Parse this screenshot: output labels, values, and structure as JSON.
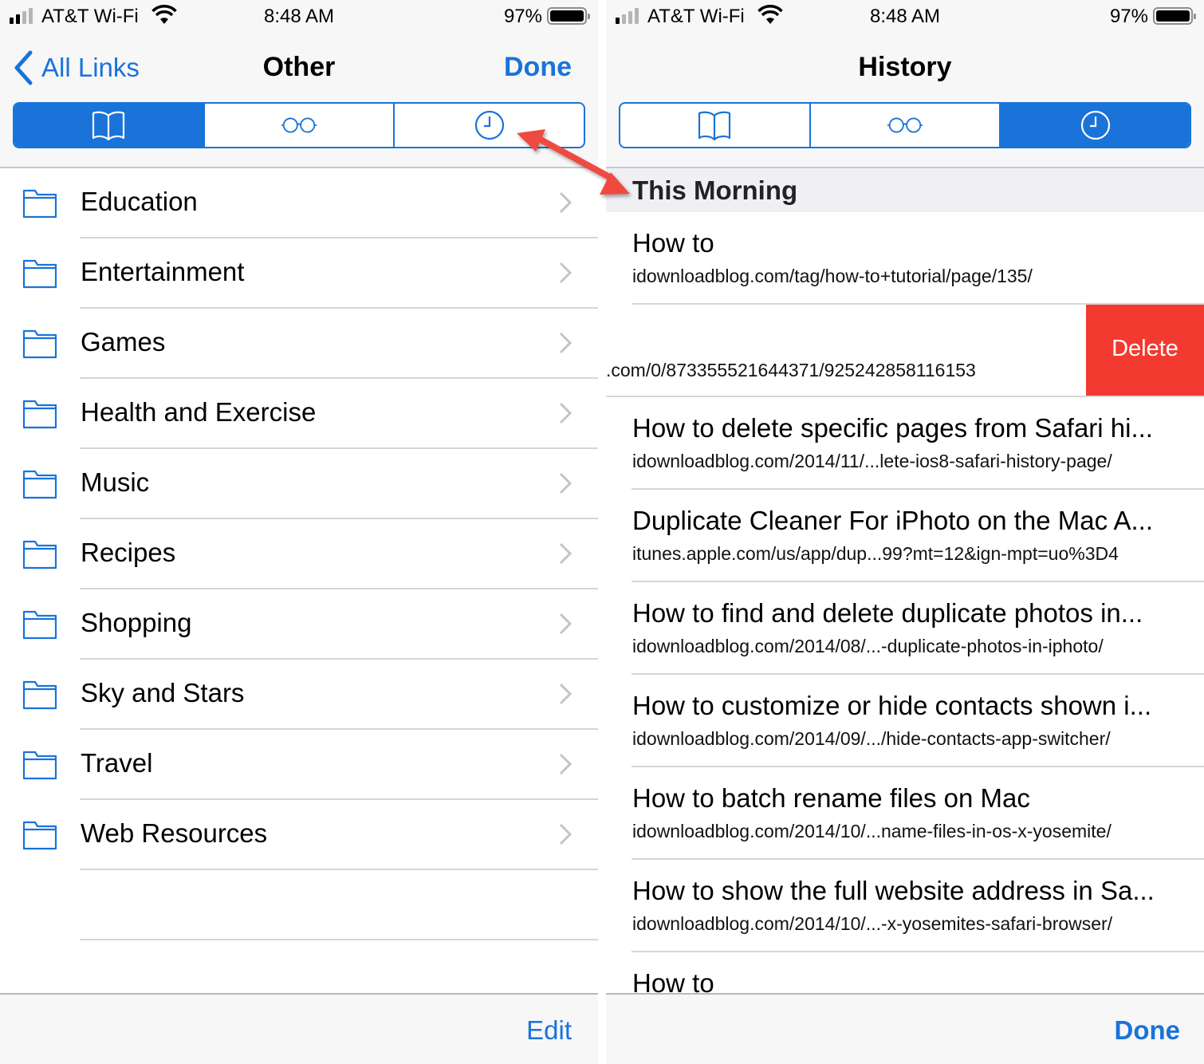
{
  "colors": {
    "accent": "#1a73d9",
    "delete": "#f23a30",
    "annotation_arrow": "#ef4a3f"
  },
  "left_screen": {
    "status_bar": {
      "carrier": "AT&T Wi-Fi",
      "time": "8:48 AM",
      "battery": "97%"
    },
    "nav": {
      "back_label": "All Links",
      "title": "Other",
      "done_label": "Done"
    },
    "segments": [
      {
        "icon": "book-icon",
        "active": true
      },
      {
        "icon": "glasses-icon",
        "active": false
      },
      {
        "icon": "clock-icon",
        "active": false
      }
    ],
    "folders": [
      {
        "label": "Education"
      },
      {
        "label": "Entertainment"
      },
      {
        "label": "Games"
      },
      {
        "label": "Health and Exercise"
      },
      {
        "label": "Music"
      },
      {
        "label": "Recipes"
      },
      {
        "label": "Shopping"
      },
      {
        "label": "Sky and Stars"
      },
      {
        "label": "Travel"
      },
      {
        "label": "Web Resources"
      }
    ],
    "toolbar": {
      "edit_label": "Edit"
    }
  },
  "right_screen": {
    "status_bar": {
      "carrier": "AT&T Wi-Fi",
      "time": "8:48 AM",
      "battery": "97%"
    },
    "nav": {
      "title": "History"
    },
    "segments": [
      {
        "icon": "book-icon",
        "active": false
      },
      {
        "icon": "glasses-icon",
        "active": false
      },
      {
        "icon": "clock-icon",
        "active": true
      }
    ],
    "section_header": "This Morning",
    "history": [
      {
        "title": "How to",
        "url": "idownloadblog.com/tag/how-to+tutorial/page/135/"
      },
      {
        "title": "",
        "url": ".com/0/873355521644371/925242858116153",
        "swiped": true,
        "action": "Delete"
      },
      {
        "title": "How to delete specific pages from Safari hi...",
        "url": "idownloadblog.com/2014/11/...lete-ios8-safari-history-page/"
      },
      {
        "title": "Duplicate Cleaner For iPhoto on the Mac A...",
        "url": "itunes.apple.com/us/app/dup...99?mt=12&ign-mpt=uo%3D4"
      },
      {
        "title": "How to find and delete duplicate photos in...",
        "url": "idownloadblog.com/2014/08/...-duplicate-photos-in-iphoto/"
      },
      {
        "title": "How to customize or hide contacts shown i...",
        "url": "idownloadblog.com/2014/09/.../hide-contacts-app-switcher/"
      },
      {
        "title": "How to batch rename files on Mac",
        "url": "idownloadblog.com/2014/10/...name-files-in-os-x-yosemite/"
      },
      {
        "title": "How to show the full website address in Sa...",
        "url": "idownloadblog.com/2014/10/...-x-yosemites-safari-browser/"
      },
      {
        "title": "How to",
        "url": ""
      }
    ],
    "toolbar": {
      "done_label": "Done"
    }
  }
}
